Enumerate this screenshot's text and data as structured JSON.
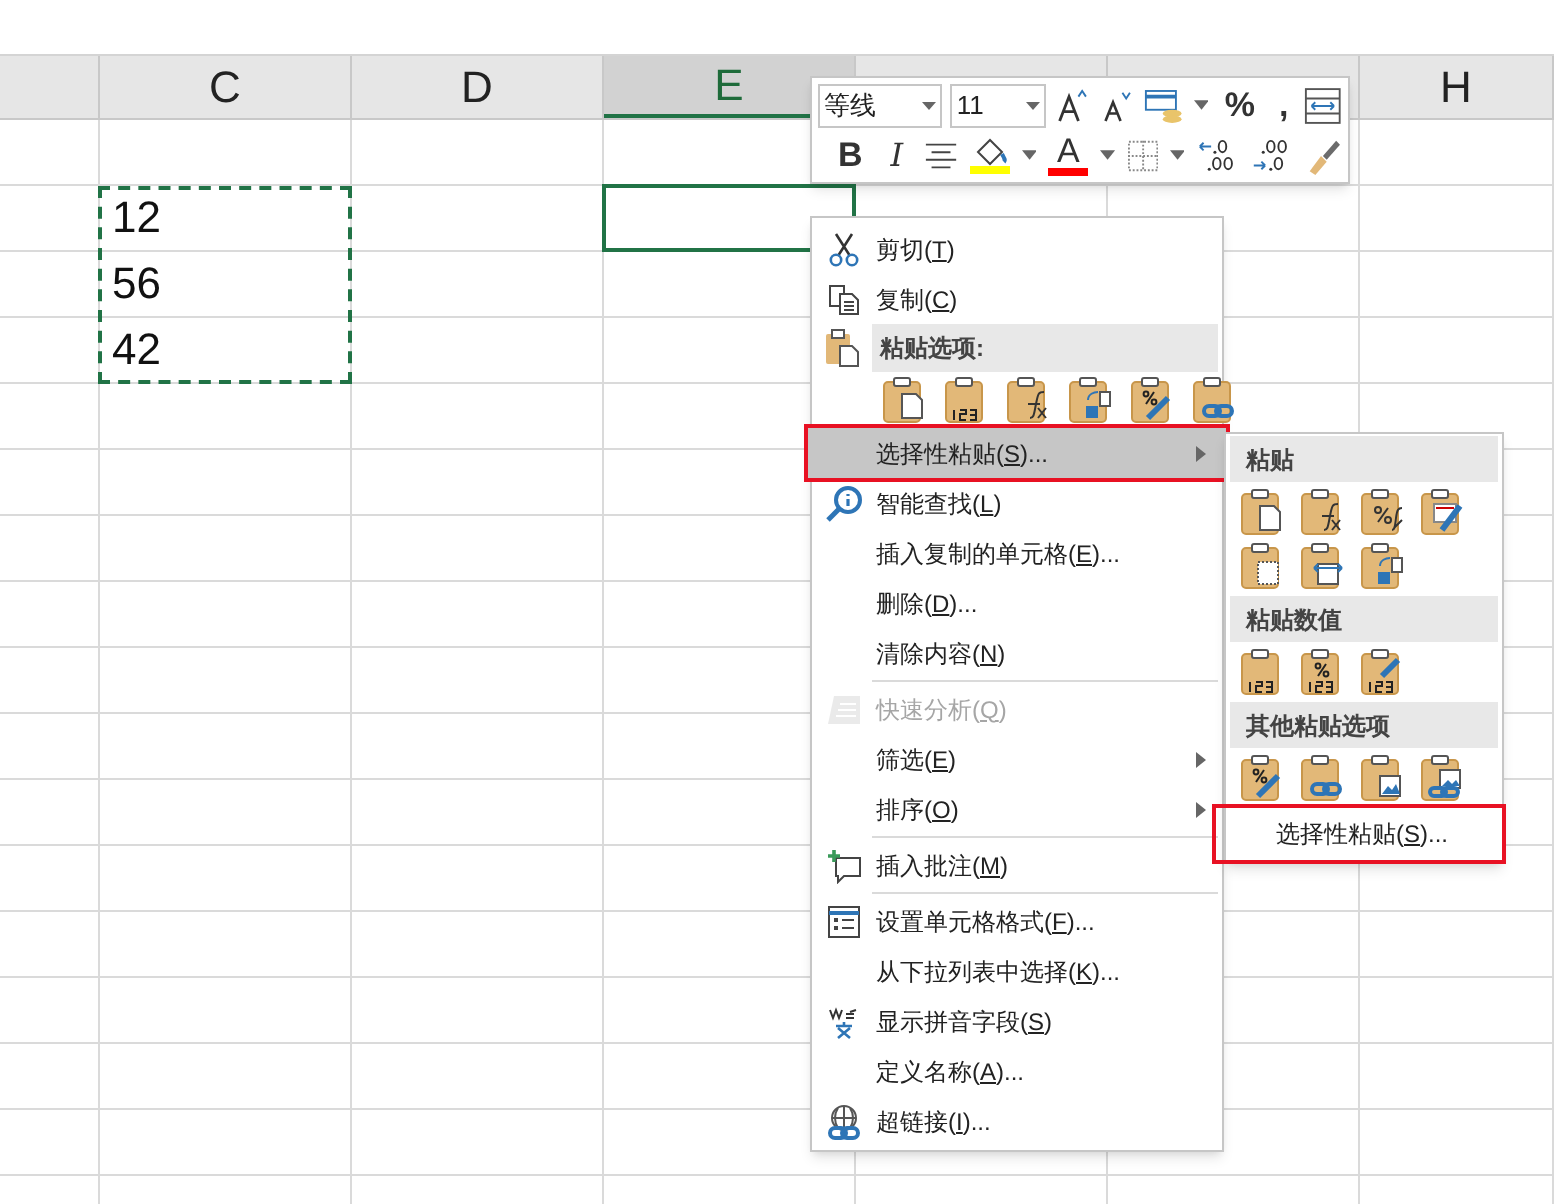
{
  "sheet": {
    "columns": [
      {
        "label": "C",
        "selected": false
      },
      {
        "label": "D",
        "selected": false
      },
      {
        "label": "E",
        "selected": true
      },
      {
        "label": "H",
        "selected": false
      }
    ],
    "copied_values": [
      "12",
      "56",
      "42"
    ]
  },
  "mini_toolbar": {
    "font_family": "等线",
    "font_size": "11",
    "row1": [
      {
        "kind": "grow-font"
      },
      {
        "kind": "shrink-font"
      },
      {
        "kind": "format-table"
      },
      {
        "kind": "dropdown"
      },
      {
        "kind": "glyph",
        "label": "%"
      },
      {
        "kind": "glyph",
        "label": ","
      },
      {
        "kind": "wrap"
      }
    ],
    "row2": [
      {
        "kind": "glyph",
        "label": "B"
      },
      {
        "kind": "glyph-italic",
        "label": "I"
      },
      {
        "kind": "align"
      },
      {
        "kind": "fill",
        "color": "#ffff00"
      },
      {
        "kind": "dropdown"
      },
      {
        "kind": "font-color",
        "label": "A",
        "color": "#ff0000"
      },
      {
        "kind": "dropdown"
      },
      {
        "kind": "borders"
      },
      {
        "kind": "dropdown"
      },
      {
        "kind": "inc-decimal"
      },
      {
        "kind": "dec-decimal"
      },
      {
        "kind": "painter"
      }
    ]
  },
  "context_menu": {
    "items": [
      {
        "kind": "command",
        "text": "剪切(",
        "key": "T",
        "after": ")",
        "disabled": false,
        "submenu": false,
        "selected": false,
        "annotated": false
      },
      {
        "kind": "command",
        "text": "复制(",
        "key": "C",
        "after": ")",
        "disabled": false,
        "submenu": false,
        "selected": false,
        "annotated": false
      },
      {
        "kind": "header",
        "text": "粘贴选项:"
      },
      {
        "kind": "paste-icons"
      },
      {
        "kind": "command",
        "text": "选择性粘贴(",
        "key": "S",
        "after": ")...",
        "disabled": false,
        "submenu": true,
        "selected": true,
        "annotated": true
      },
      {
        "kind": "command",
        "text": "智能查找(",
        "key": "L",
        "after": ")",
        "disabled": false,
        "submenu": false,
        "selected": false,
        "annotated": false
      },
      {
        "kind": "command",
        "text": "插入复制的单元格(",
        "key": "E",
        "after": ")...",
        "disabled": false,
        "submenu": false,
        "selected": false,
        "annotated": false
      },
      {
        "kind": "command",
        "text": "删除(",
        "key": "D",
        "after": ")...",
        "disabled": false,
        "submenu": false,
        "selected": false,
        "annotated": false
      },
      {
        "kind": "command",
        "text": "清除内容(",
        "key": "N",
        "after": ")",
        "disabled": false,
        "submenu": false,
        "selected": false,
        "annotated": false
      },
      {
        "kind": "separator"
      },
      {
        "kind": "command",
        "text": "快速分析(",
        "key": "Q",
        "after": ")",
        "disabled": true,
        "submenu": false,
        "selected": false,
        "annotated": false
      },
      {
        "kind": "command",
        "text": "筛选(",
        "key": "E",
        "after": ")",
        "disabled": false,
        "submenu": true,
        "selected": false,
        "annotated": false
      },
      {
        "kind": "command",
        "text": "排序(",
        "key": "O",
        "after": ")",
        "disabled": false,
        "submenu": true,
        "selected": false,
        "annotated": false
      },
      {
        "kind": "separator"
      },
      {
        "kind": "command",
        "text": "插入批注(",
        "key": "M",
        "after": ")",
        "disabled": false,
        "submenu": false,
        "selected": false,
        "annotated": false
      },
      {
        "kind": "separator"
      },
      {
        "kind": "command",
        "text": "设置单元格格式(",
        "key": "F",
        "after": ")...",
        "disabled": false,
        "submenu": false,
        "selected": false,
        "annotated": false
      },
      {
        "kind": "command",
        "text": "从下拉列表中选择(",
        "key": "K",
        "after": ")...",
        "disabled": false,
        "submenu": false,
        "selected": false,
        "annotated": false
      },
      {
        "kind": "command",
        "text": "显示拼音字段(",
        "key": "S",
        "after": ")",
        "disabled": false,
        "submenu": false,
        "selected": false,
        "annotated": false
      },
      {
        "kind": "command",
        "text": "定义名称(",
        "key": "A",
        "after": ")...",
        "disabled": false,
        "submenu": false,
        "selected": false,
        "annotated": false
      },
      {
        "kind": "command",
        "text": "超链接(",
        "key": "I",
        "after": ")...",
        "disabled": false,
        "submenu": false,
        "selected": false,
        "annotated": false
      }
    ]
  },
  "submenu": {
    "items": [
      {
        "kind": "header",
        "text": "粘贴"
      },
      {
        "kind": "icons"
      },
      {
        "kind": "header",
        "text": "粘贴数值"
      },
      {
        "kind": "icons"
      },
      {
        "kind": "header",
        "text": "其他粘贴选项"
      },
      {
        "kind": "icons"
      },
      {
        "kind": "command",
        "text": "选择性粘贴(",
        "key": "S",
        "after": ")...",
        "annotated": true
      }
    ]
  }
}
